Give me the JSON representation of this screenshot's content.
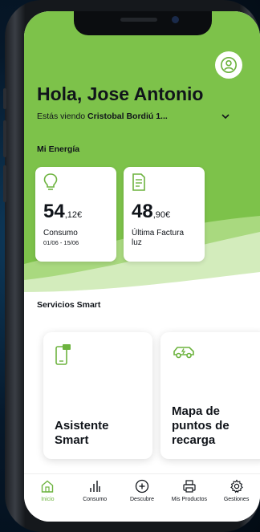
{
  "header": {
    "greeting": "Hola, Jose Antonio",
    "viewing_prefix": "Estás viendo ",
    "viewing_address": "Cristobal Bordiú 1..."
  },
  "energy": {
    "section_title": "Mi Energía",
    "cards": [
      {
        "icon": "lightbulb-icon",
        "amount_int": "54",
        "amount_dec": ",12€",
        "label": "Consumo",
        "sub": "01/06 - 15/06"
      },
      {
        "icon": "invoice-icon",
        "amount_int": "48",
        "amount_dec": ",90€",
        "label": "Última Factura luz",
        "sub": ""
      }
    ]
  },
  "smart": {
    "section_title": "Servicios Smart",
    "cards": [
      {
        "icon": "smartphone-chat-icon",
        "title": "Asistente Smart"
      },
      {
        "icon": "electric-car-icon",
        "title": "Mapa de puntos de recarga"
      }
    ]
  },
  "tabs": [
    {
      "label": "Inicio",
      "icon": "home-icon",
      "active": true
    },
    {
      "label": "Consumo",
      "icon": "bar-chart-icon",
      "active": false
    },
    {
      "label": "Descubre",
      "icon": "plus-circle-icon",
      "active": false
    },
    {
      "label": "Mis Productos",
      "icon": "printer-icon",
      "active": false
    },
    {
      "label": "Gestiones",
      "icon": "gear-icon",
      "active": false
    }
  ],
  "colors": {
    "brand_green": "#7dc24a",
    "active_tab": "#6db33f",
    "icon_green": "#6db33f"
  }
}
